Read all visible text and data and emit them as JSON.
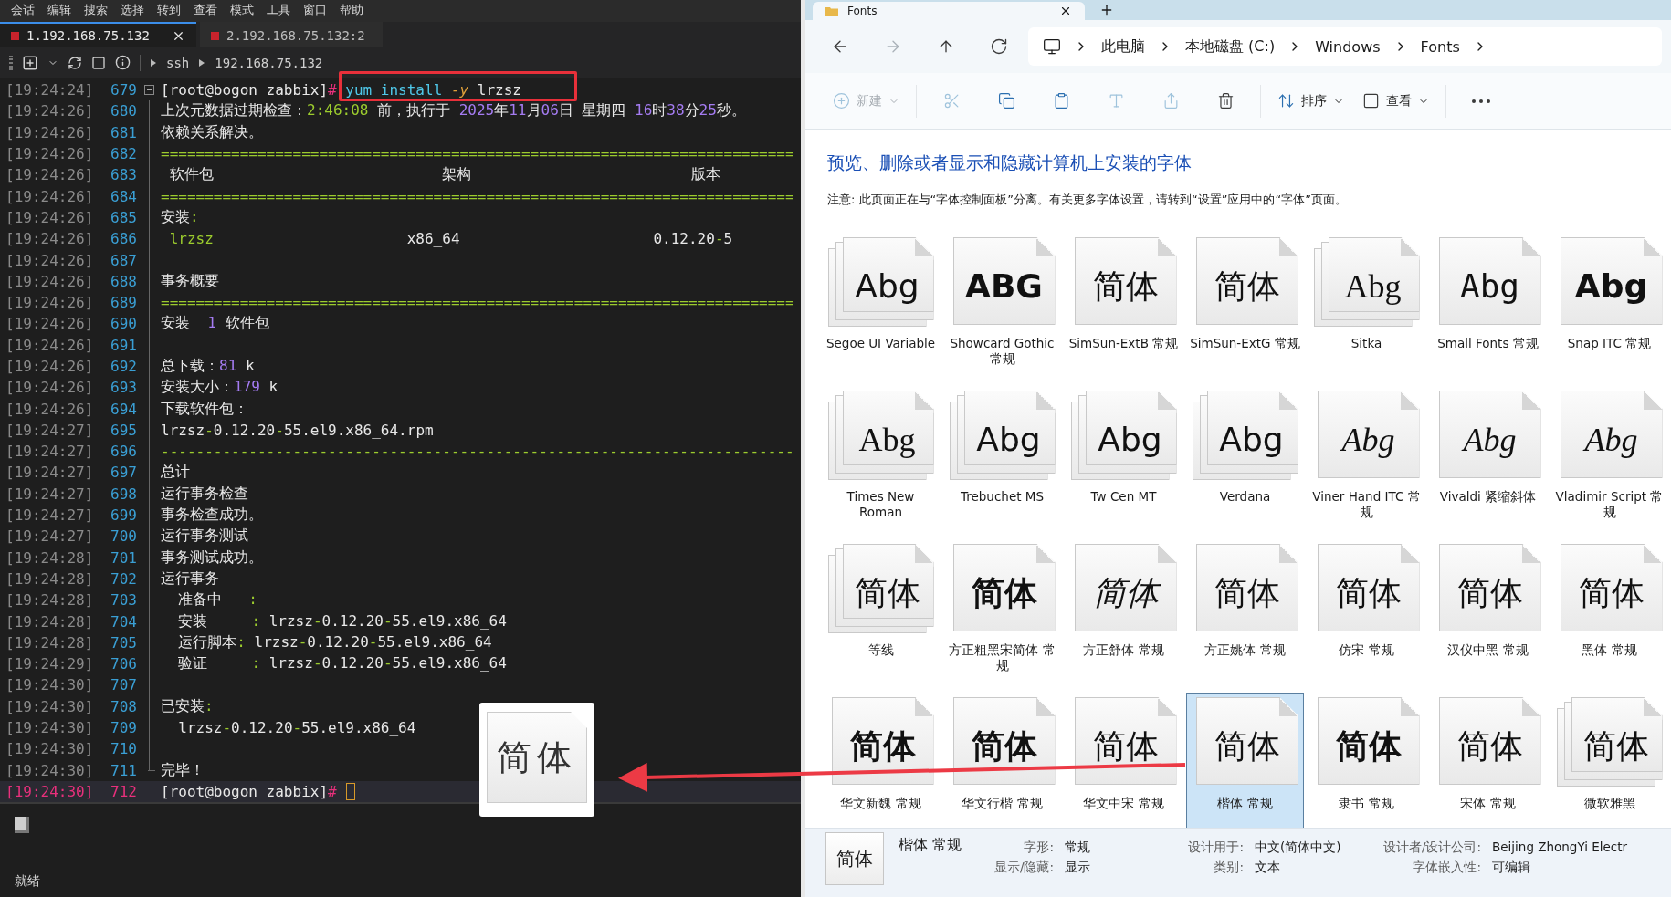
{
  "terminal": {
    "menu": [
      "会话",
      "编辑",
      "搜索",
      "选择",
      "转到",
      "查看",
      "模式",
      "工具",
      "窗口",
      "帮助"
    ],
    "tabs": [
      {
        "label": "1.192.168.75.132",
        "selected": true,
        "closable": true
      },
      {
        "label": "2.192.168.75.132:2",
        "selected": false,
        "closable": false
      }
    ],
    "path": [
      "ssh",
      "192.168.75.132"
    ],
    "lines": [
      {
        "time": "[19:24:24]",
        "number": "679",
        "current": false,
        "segments": [
          {
            "kind": "plain",
            "text": "[root@bogon zabbix]"
          },
          {
            "kind": "hash",
            "text": "#"
          },
          {
            "kind": "cmd",
            "text": " yum install "
          },
          {
            "kind": "flag",
            "text": "-y"
          },
          {
            "kind": "plain",
            "text": " lrzsz"
          }
        ]
      },
      {
        "time": "[19:24:26]",
        "number": "680",
        "current": false,
        "segments": [
          {
            "kind": "plain",
            "text": "上次元数据过期检查："
          },
          {
            "kind": "accent",
            "text": "2:46:08"
          },
          {
            "kind": "plain",
            "text": " 前，执行于 "
          },
          {
            "kind": "num",
            "text": "2025"
          },
          {
            "kind": "plain",
            "text": "年"
          },
          {
            "kind": "num",
            "text": "11"
          },
          {
            "kind": "plain",
            "text": "月"
          },
          {
            "kind": "num",
            "text": "06"
          },
          {
            "kind": "plain",
            "text": "日 星期四 "
          },
          {
            "kind": "num",
            "text": "16"
          },
          {
            "kind": "plain",
            "text": "时"
          },
          {
            "kind": "num",
            "text": "38"
          },
          {
            "kind": "plain",
            "text": "分"
          },
          {
            "kind": "num",
            "text": "25"
          },
          {
            "kind": "plain",
            "text": "秒。"
          }
        ]
      },
      {
        "time": "[19:24:26]",
        "number": "681",
        "current": false,
        "segments": [
          {
            "kind": "plain",
            "text": "依赖关系解决。"
          }
        ]
      },
      {
        "time": "[19:24:26]",
        "number": "682",
        "current": false,
        "segments": [
          {
            "kind": "accent",
            "text": "========================================================================"
          }
        ]
      },
      {
        "time": "[19:24:26]",
        "number": "683",
        "current": false,
        "segments": [
          {
            "kind": "plain",
            "text": " 软件包                          架构                         版本"
          }
        ]
      },
      {
        "time": "[19:24:26]",
        "number": "684",
        "current": false,
        "segments": [
          {
            "kind": "accent",
            "text": "========================================================================"
          }
        ]
      },
      {
        "time": "[19:24:26]",
        "number": "685",
        "current": false,
        "segments": [
          {
            "kind": "plain",
            "text": "安装"
          },
          {
            "kind": "accent",
            "text": ":"
          }
        ]
      },
      {
        "time": "[19:24:26]",
        "number": "686",
        "current": false,
        "segments": [
          {
            "kind": "accent",
            "text": " lrzsz"
          },
          {
            "kind": "plain",
            "text": "                      x86_64                      0.12.20"
          },
          {
            "kind": "accent",
            "text": "-"
          },
          {
            "kind": "plain",
            "text": "5"
          }
        ]
      },
      {
        "time": "[19:24:26]",
        "number": "687",
        "current": false
      },
      {
        "time": "[19:24:26]",
        "number": "688",
        "current": false,
        "segments": [
          {
            "kind": "plain",
            "text": "事务概要"
          }
        ]
      },
      {
        "time": "[19:24:26]",
        "number": "689",
        "current": false,
        "segments": [
          {
            "kind": "accent",
            "text": "========================================================================"
          }
        ]
      },
      {
        "time": "[19:24:26]",
        "number": "690",
        "current": false,
        "segments": [
          {
            "kind": "plain",
            "text": "安装  "
          },
          {
            "kind": "num",
            "text": "1"
          },
          {
            "kind": "plain",
            "text": " 软件包"
          }
        ]
      },
      {
        "time": "[19:24:26]",
        "number": "691",
        "current": false
      },
      {
        "time": "[19:24:26]",
        "number": "692",
        "current": false,
        "segments": [
          {
            "kind": "plain",
            "text": "总下载："
          },
          {
            "kind": "num",
            "text": "81"
          },
          {
            "kind": "plain",
            "text": " k"
          }
        ]
      },
      {
        "time": "[19:24:26]",
        "number": "693",
        "current": false,
        "segments": [
          {
            "kind": "plain",
            "text": "安装大小："
          },
          {
            "kind": "num",
            "text": "179"
          },
          {
            "kind": "plain",
            "text": " k"
          }
        ]
      },
      {
        "time": "[19:24:26]",
        "number": "694",
        "current": false,
        "segments": [
          {
            "kind": "plain",
            "text": "下载软件包："
          }
        ]
      },
      {
        "time": "[19:24:27]",
        "number": "695",
        "current": false,
        "segments": [
          {
            "kind": "plain",
            "text": "lrzsz"
          },
          {
            "kind": "accent",
            "text": "-"
          },
          {
            "kind": "plain",
            "text": "0.12.20"
          },
          {
            "kind": "accent",
            "text": "-"
          },
          {
            "kind": "plain",
            "text": "55.el9.x86_64.rpm"
          }
        ]
      },
      {
        "time": "[19:24:27]",
        "number": "696",
        "current": false,
        "segments": [
          {
            "kind": "accent",
            "text": "------------------------------------------------------------------------"
          }
        ]
      },
      {
        "time": "[19:24:27]",
        "number": "697",
        "current": false,
        "segments": [
          {
            "kind": "plain",
            "text": "总计"
          }
        ]
      },
      {
        "time": "[19:24:27]",
        "number": "698",
        "current": false,
        "segments": [
          {
            "kind": "plain",
            "text": "运行事务检查"
          }
        ]
      },
      {
        "time": "[19:24:27]",
        "number": "699",
        "current": false,
        "segments": [
          {
            "kind": "plain",
            "text": "事务检查成功。"
          }
        ]
      },
      {
        "time": "[19:24:27]",
        "number": "700",
        "current": false,
        "segments": [
          {
            "kind": "plain",
            "text": "运行事务测试"
          }
        ]
      },
      {
        "time": "[19:24:28]",
        "number": "701",
        "current": false,
        "segments": [
          {
            "kind": "plain",
            "text": "事务测试成功。"
          }
        ]
      },
      {
        "time": "[19:24:28]",
        "number": "702",
        "current": false,
        "segments": [
          {
            "kind": "plain",
            "text": "运行事务"
          }
        ]
      },
      {
        "time": "[19:24:28]",
        "number": "703",
        "current": false,
        "segments": [
          {
            "kind": "plain",
            "text": "  准备中   "
          },
          {
            "kind": "accent",
            "text": ":"
          }
        ]
      },
      {
        "time": "[19:24:28]",
        "number": "704",
        "current": false,
        "segments": [
          {
            "kind": "plain",
            "text": "  安装     "
          },
          {
            "kind": "accent",
            "text": ":"
          },
          {
            "kind": "plain",
            "text": " lrzsz"
          },
          {
            "kind": "accent",
            "text": "-"
          },
          {
            "kind": "plain",
            "text": "0.12.20"
          },
          {
            "kind": "accent",
            "text": "-"
          },
          {
            "kind": "plain",
            "text": "55.el9.x86_64"
          }
        ]
      },
      {
        "time": "[19:24:28]",
        "number": "705",
        "current": false,
        "segments": [
          {
            "kind": "plain",
            "text": "  运行脚本"
          },
          {
            "kind": "accent",
            "text": ":"
          },
          {
            "kind": "plain",
            "text": " lrzsz"
          },
          {
            "kind": "accent",
            "text": "-"
          },
          {
            "kind": "plain",
            "text": "0.12.20"
          },
          {
            "kind": "accent",
            "text": "-"
          },
          {
            "kind": "plain",
            "text": "55.el9.x86_64"
          }
        ]
      },
      {
        "time": "[19:24:29]",
        "number": "706",
        "current": false,
        "segments": [
          {
            "kind": "plain",
            "text": "  验证     "
          },
          {
            "kind": "accent",
            "text": ":"
          },
          {
            "kind": "plain",
            "text": " lrzsz"
          },
          {
            "kind": "accent",
            "text": "-"
          },
          {
            "kind": "plain",
            "text": "0.12.20"
          },
          {
            "kind": "accent",
            "text": "-"
          },
          {
            "kind": "plain",
            "text": "55.el9.x86_64"
          }
        ]
      },
      {
        "time": "[19:24:30]",
        "number": "707",
        "current": false
      },
      {
        "time": "[19:24:30]",
        "number": "708",
        "current": false,
        "segments": [
          {
            "kind": "plain",
            "text": "已安装"
          },
          {
            "kind": "accent",
            "text": ":"
          }
        ]
      },
      {
        "time": "[19:24:30]",
        "number": "709",
        "current": false,
        "segments": [
          {
            "kind": "plain",
            "text": "  lrzsz"
          },
          {
            "kind": "accent",
            "text": "-"
          },
          {
            "kind": "plain",
            "text": "0.12.20"
          },
          {
            "kind": "accent",
            "text": "-"
          },
          {
            "kind": "plain",
            "text": "55.el9.x86_64"
          }
        ]
      },
      {
        "time": "[19:24:30]",
        "number": "710",
        "current": false
      },
      {
        "time": "[19:24:30]",
        "number": "711",
        "current": false,
        "segments": [
          {
            "kind": "plain",
            "text": "完毕！"
          }
        ]
      },
      {
        "time": "[19:24:30]",
        "number": "712",
        "current": true,
        "segments": [
          {
            "kind": "plain",
            "text": "[root@bogon zabbix]"
          },
          {
            "kind": "hash",
            "text": "#"
          }
        ]
      }
    ],
    "status": "就绪"
  },
  "drag_preview": {
    "sample": "简体"
  },
  "explorer": {
    "tab": {
      "title": "Fonts"
    },
    "nav": [
      {
        "kind": "back",
        "disabled": false
      },
      {
        "kind": "forward",
        "disabled": true
      },
      {
        "kind": "up",
        "disabled": false
      },
      {
        "kind": "refresh",
        "disabled": false
      }
    ],
    "breadcrumbs": [
      "此电脑",
      "本地磁盘 (C:)",
      "Windows",
      "Fonts"
    ],
    "commands": [
      {
        "kind": "new",
        "label": "新建",
        "disabled": true
      },
      {
        "kind": "cut",
        "disabled": true
      },
      {
        "kind": "copy",
        "disabled": false
      },
      {
        "kind": "paste",
        "disabled": false
      },
      {
        "kind": "rename",
        "disabled": true
      },
      {
        "kind": "share",
        "disabled": true
      },
      {
        "kind": "delete",
        "disabled": false
      },
      {
        "kind": "sort",
        "label": "排序",
        "disabled": false
      },
      {
        "kind": "view",
        "label": "查看",
        "disabled": false
      },
      {
        "kind": "more",
        "disabled": false
      }
    ],
    "heading": "预览、删除或者显示和隐藏计算机上安装的字体",
    "note": "注意: 此页面正在与“字体控制面板”分离。有关更多字体设置，请转到“设置”应用中的“字体”页面。",
    "fonts": [
      {
        "name": "Segoe UI Variable",
        "sample": "Abg",
        "kind": "stack",
        "selected": false
      },
      {
        "name": "Showcard Gothic 常规",
        "sample": "ABG",
        "kind": "single",
        "selected": false
      },
      {
        "name": "SimSun-ExtB 常规",
        "sample": "简体",
        "kind": "single",
        "selected": false
      },
      {
        "name": "SimSun-ExtG 常规",
        "sample": "简体",
        "kind": "single",
        "selected": false
      },
      {
        "name": "Sitka",
        "sample": "Abg",
        "kind": "stack",
        "selected": false
      },
      {
        "name": "Small Fonts 常规",
        "sample": "Abg",
        "kind": "single",
        "selected": false
      },
      {
        "name": "Snap ITC 常规",
        "sample": "Abg",
        "kind": "single",
        "selected": false
      },
      {
        "name": "Times New Roman",
        "sample": "Abg",
        "kind": "stack",
        "selected": false
      },
      {
        "name": "Trebuchet MS",
        "sample": "Abg",
        "kind": "stack",
        "selected": false
      },
      {
        "name": "Tw Cen MT",
        "sample": "Abg",
        "kind": "stack",
        "selected": false
      },
      {
        "name": "Verdana",
        "sample": "Abg",
        "kind": "stack",
        "selected": false
      },
      {
        "name": "Viner Hand ITC 常规",
        "sample": "Abg",
        "kind": "single",
        "selected": false
      },
      {
        "name": "Vivaldi 紧缩斜体",
        "sample": "Abg",
        "kind": "single",
        "selected": false
      },
      {
        "name": "Vladimir Script 常规",
        "sample": "Abg",
        "kind": "single",
        "selected": false
      },
      {
        "name": "等线",
        "sample": "简体",
        "kind": "stack",
        "selected": false
      },
      {
        "name": "方正粗黑宋简体 常规",
        "sample": "简体",
        "kind": "single",
        "selected": false
      },
      {
        "name": "方正舒体 常规",
        "sample": "简体",
        "kind": "single",
        "selected": false
      },
      {
        "name": "方正姚体 常规",
        "sample": "简体",
        "kind": "single",
        "selected": false
      },
      {
        "name": "仿宋 常规",
        "sample": "简体",
        "kind": "single",
        "selected": false
      },
      {
        "name": "汉仪中黑 常规",
        "sample": "简体",
        "kind": "single",
        "selected": false
      },
      {
        "name": "黑体 常规",
        "sample": "简体",
        "kind": "single",
        "selected": false
      },
      {
        "name": "华文新魏 常规",
        "sample": "简体",
        "kind": "single",
        "selected": false
      },
      {
        "name": "华文行楷 常规",
        "sample": "简体",
        "kind": "single",
        "selected": false
      },
      {
        "name": "华文中宋 常规",
        "sample": "简体",
        "kind": "single",
        "selected": false
      },
      {
        "name": "楷体 常规",
        "sample": "简体",
        "kind": "single",
        "selected": true
      },
      {
        "name": "隶书 常规",
        "sample": "简体",
        "kind": "single",
        "selected": false
      },
      {
        "name": "宋体 常规",
        "sample": "简体",
        "kind": "single",
        "selected": false
      },
      {
        "name": "微软雅黑",
        "sample": "简体",
        "kind": "stack",
        "selected": false
      }
    ],
    "details": {
      "sample": "简体",
      "name": "楷体 常规",
      "groups": [
        [
          {
            "label": "字形:",
            "value": "常规"
          },
          {
            "label": "显示/隐藏:",
            "value": "显示"
          }
        ],
        [
          {
            "label": "设计用于:",
            "value": "中文(简体中文)"
          },
          {
            "label": "类别:",
            "value": "文本"
          }
        ],
        [
          {
            "label": "设计者/设计公司:",
            "value": "Beijing ZhongYi Electr"
          },
          {
            "label": "字体嵌入性:",
            "value": "可编辑"
          }
        ]
      ]
    }
  }
}
